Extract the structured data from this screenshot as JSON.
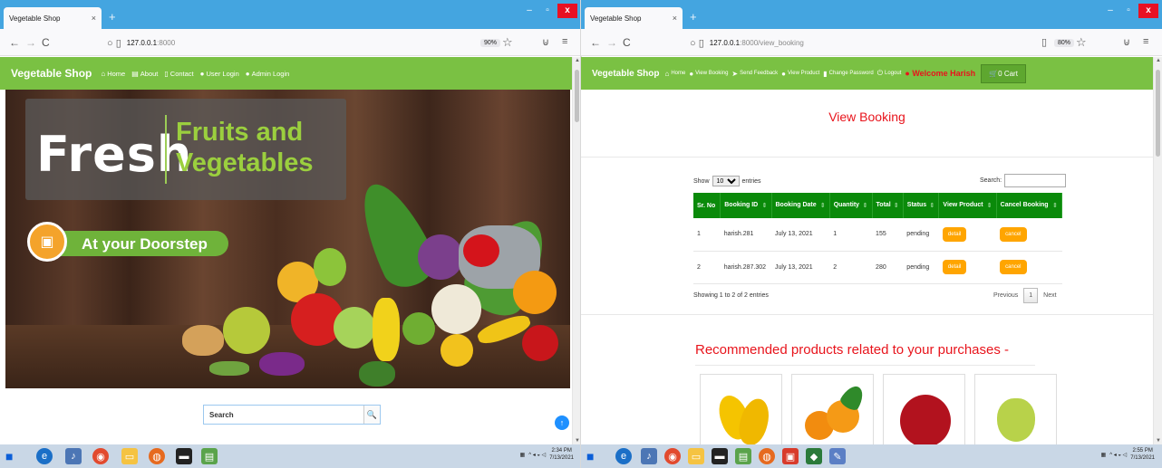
{
  "left": {
    "tab": {
      "title": "Vegetable Shop",
      "close": "×",
      "new": "+"
    },
    "window": {
      "min": "–",
      "max": "▫",
      "close": "x"
    },
    "toolbar": {
      "back": "←",
      "forward": "→",
      "reload": "C",
      "url_host": "127.0.0.1",
      "url_rest": ":8000",
      "zoom": "90%",
      "star": "☆",
      "pocket": "⊍",
      "menu": "≡"
    },
    "nav": {
      "brand": "Vegetable Shop",
      "links": [
        {
          "icon": "home-icon",
          "glyph": "⌂",
          "label": "Home"
        },
        {
          "icon": "about-icon",
          "glyph": "▤",
          "label": "About"
        },
        {
          "icon": "contact-icon",
          "glyph": "▯",
          "label": "Contact"
        },
        {
          "icon": "user-icon",
          "glyph": "●",
          "label": "User Login"
        },
        {
          "icon": "admin-icon",
          "glyph": "●",
          "label": "Admin Login"
        }
      ]
    },
    "hero": {
      "fresh": "Fresh",
      "line1": "Fruits and",
      "line2": "Vegetables",
      "doorstep": "At your Doorstep"
    },
    "search": {
      "placeholder": "Search",
      "button": "🔍"
    },
    "totop": "↑",
    "taskbar": {
      "time": "2:34 PM",
      "date": "7/13/2021"
    }
  },
  "right": {
    "tab": {
      "title": "Vegetable Shop",
      "close": "×",
      "new": "+"
    },
    "window": {
      "min": "–",
      "max": "▫",
      "close": "x"
    },
    "toolbar": {
      "back": "←",
      "forward": "→",
      "reload": "C",
      "url_host": "127.0.0.1",
      "url_rest": ":8000/view_booking",
      "zoom": "80%",
      "star": "☆",
      "pocket": "⊍",
      "menu": "≡",
      "reader": "▯"
    },
    "nav": {
      "brand": "Vegetable Shop",
      "links": [
        {
          "icon": "home-icon",
          "glyph": "⌂",
          "label": "Home"
        },
        {
          "icon": "view-booking-icon",
          "glyph": "●",
          "label": "View Booking"
        },
        {
          "icon": "send-icon",
          "glyph": "➤",
          "label": "Send Feedback"
        },
        {
          "icon": "view-product-icon",
          "glyph": "●",
          "label": "View Product"
        },
        {
          "icon": "password-icon",
          "glyph": "▮",
          "label": "Change Password"
        },
        {
          "icon": "logout-icon",
          "glyph": "⏻",
          "label": "Logout"
        }
      ],
      "welcome": "Welcome Harish",
      "cart": "0 Cart",
      "cart_glyph": "🛒"
    },
    "title": "View Booking",
    "datatable": {
      "show": "Show",
      "entries": "entries",
      "page_len": "10",
      "search_label": "Search:",
      "columns": [
        "Sr. No",
        "Booking ID",
        "Booking Date",
        "Quantity",
        "Total",
        "Status",
        "View Product",
        "Cancel Booking"
      ],
      "rows": [
        {
          "sr": "1",
          "id": "harish.281",
          "date": "July 13, 2021",
          "qty": "1",
          "total": "155",
          "status": "pending",
          "view": "detail",
          "cancel": "cancel"
        },
        {
          "sr": "2",
          "id": "harish.287.302",
          "date": "July 13, 2021",
          "qty": "2",
          "total": "280",
          "status": "pending",
          "view": "detail",
          "cancel": "cancel"
        }
      ],
      "showing": "Showing 1 to 2 of 2 entries",
      "previous": "Previous",
      "page": "1",
      "next": "Next"
    },
    "recommended": "Recommended products related to your purchases -",
    "taskbar": {
      "time": "2:55 PM",
      "date": "7/13/2021"
    }
  }
}
